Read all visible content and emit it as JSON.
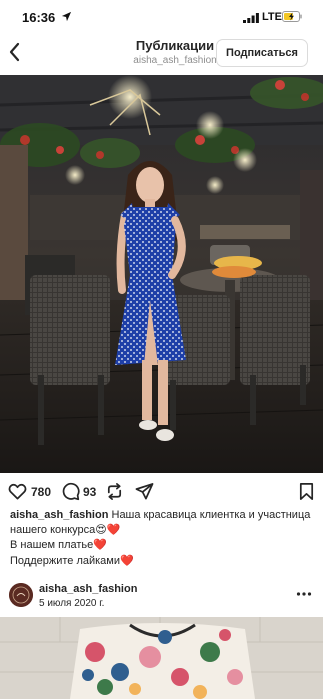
{
  "status_bar": {
    "time": "16:36",
    "network": "LTE",
    "icons": [
      "location-arrow-icon",
      "signal-bars-icon",
      "battery-charging-icon"
    ]
  },
  "nav": {
    "title": "Публикации",
    "subtitle": "aisha_ash_fashion",
    "follow_label": "Подписаться",
    "back_icon": "chevron-left-icon"
  },
  "post": {
    "likes": "780",
    "comments": "93",
    "icons": [
      "heart-icon",
      "comment-icon",
      "repost-icon",
      "send-icon",
      "bookmark-icon"
    ],
    "caption": {
      "username": "aisha_ash_fashion",
      "line1": "Наша красавица клиентка и участница",
      "line2": "нашего конкурса😍❤️",
      "line3": "В нашем платье❤️",
      "line4": "Поддержите лайками❤️"
    }
  },
  "next_post": {
    "username": "aisha_ash_fashion",
    "date": "5 июля 2020 г.",
    "more_icon": "more-horizontal-icon"
  },
  "colors": {
    "text": "#262626",
    "secondary": "#8e8e8e",
    "border": "#dbdbdb",
    "dress_blue": "#1e3fa8"
  }
}
